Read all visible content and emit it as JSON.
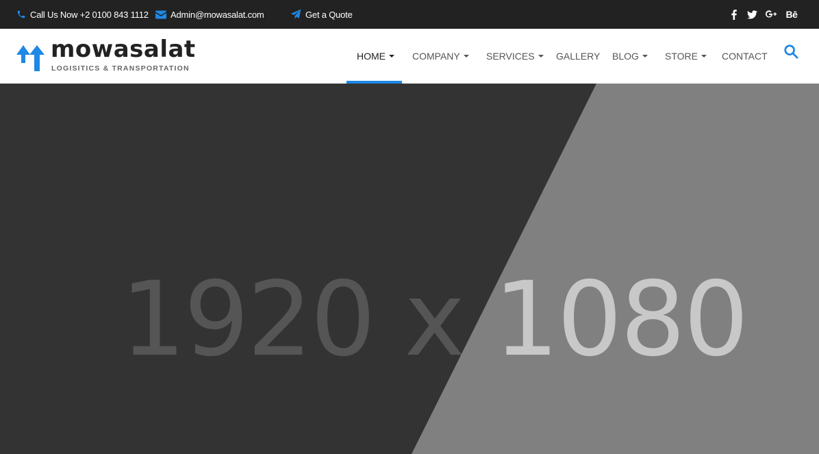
{
  "topbar": {
    "phone": "Call Us Now +2 0100 843 1112",
    "email": "Admin@mowasalat.com",
    "quote": "Get a Quote",
    "social": [
      {
        "icon": "facebook-icon"
      },
      {
        "icon": "twitter-icon"
      },
      {
        "icon": "google-plus-icon"
      },
      {
        "icon": "behance-icon",
        "label": "Bē"
      }
    ]
  },
  "brand": {
    "name": "mowasalat",
    "tagline": "LOGISITICS & TRANSPORTATION",
    "accent_color": "#1e88e5"
  },
  "nav": {
    "items": [
      {
        "label": "HOME",
        "dropdown": true,
        "active": true
      },
      {
        "label": "COMPANY",
        "dropdown": true
      },
      {
        "label": "SERVICES",
        "dropdown": true
      },
      {
        "label": "GALLERY",
        "dropdown": false
      },
      {
        "label": "BLOG",
        "dropdown": true
      },
      {
        "label": "STORE",
        "dropdown": true
      },
      {
        "label": "CONTACT",
        "dropdown": false
      }
    ],
    "search_icon": "search-icon"
  },
  "hero": {
    "placeholder_text": "1920 x 1080",
    "dark_color": "#333333",
    "light_color": "#808080"
  }
}
